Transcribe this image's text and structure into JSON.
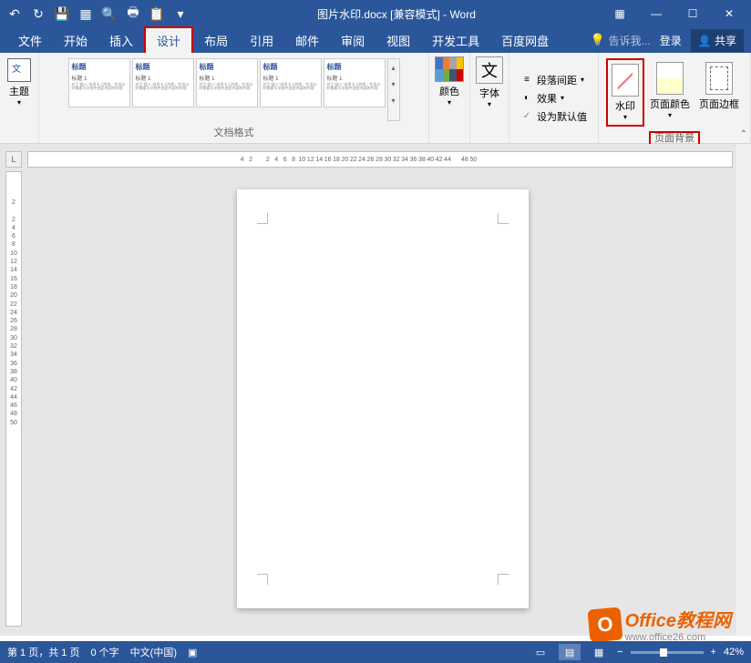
{
  "title": "图片水印.docx [兼容模式] - Word",
  "qat": {
    "back": "↶",
    "redo": "↻",
    "save": "💾",
    "new": "▦",
    "print_preview": "🔍",
    "quick_print": "🖶",
    "paste": "📋"
  },
  "window": {
    "ribbon_opts": "▦",
    "min": "—",
    "max": "☐",
    "close": "✕"
  },
  "menu": {
    "file": "文件",
    "home": "开始",
    "insert": "插入",
    "design": "设计",
    "layout": "布局",
    "references": "引用",
    "mail": "邮件",
    "review": "审阅",
    "view": "视图",
    "developer": "开发工具",
    "baidu": "百度网盘",
    "tellme": "告诉我...",
    "login": "登录",
    "share": "共享"
  },
  "ribbon": {
    "theme_label": "主题",
    "doc_format_label": "文档格式",
    "colors_label": "颜色",
    "fonts_label": "字体",
    "font_glyph": "文",
    "para_spacing": "段落间距",
    "effects": "效果",
    "set_default": "设为默认值",
    "watermark": "水印",
    "page_color": "页面颜色",
    "page_border": "页面边框",
    "page_bg_label": "页面背景",
    "style_previews": [
      {
        "title": "标题",
        "sub": "标题 1"
      },
      {
        "title": "标题",
        "sub": "标题 1"
      },
      {
        "title": "标题",
        "sub": "标题 1"
      },
      {
        "title": "标题",
        "sub": "标题 1"
      },
      {
        "title": "标题",
        "sub": "标题 1"
      }
    ]
  },
  "ruler_h": [
    "4",
    "2",
    "",
    "2",
    "4",
    "6",
    "8",
    "10",
    "12",
    "14",
    "16",
    "18",
    "20",
    "22",
    "24",
    "26",
    "28",
    "30",
    "32",
    "34",
    "36",
    "38",
    "40",
    "42",
    "44",
    "",
    "48",
    "50"
  ],
  "ruler_v": [
    "2",
    "",
    "2",
    "4",
    "6",
    "8",
    "10",
    "12",
    "14",
    "16",
    "18",
    "20",
    "22",
    "24",
    "26",
    "28",
    "30",
    "32",
    "34",
    "36",
    "38",
    "40",
    "42",
    "44",
    "46",
    "48",
    "50"
  ],
  "ruler_corner": "L",
  "watermark_brand": {
    "main": "Office教程网",
    "sub": "www.office26.com",
    "logo": "O"
  },
  "status": {
    "page": "第 1 页，共 1 页",
    "words": "0 个字",
    "lang": "中文(中国)",
    "zoom": "42%",
    "minus": "−",
    "plus": "+"
  }
}
